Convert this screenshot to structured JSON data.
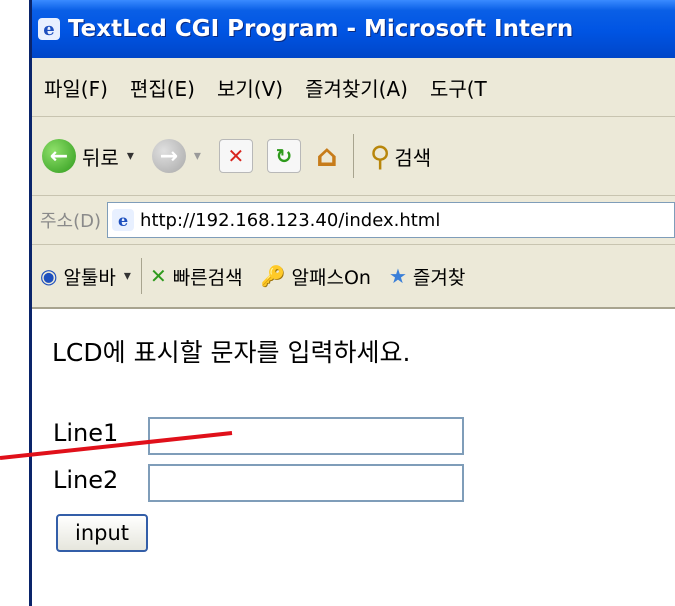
{
  "titlebar": {
    "title": "TextLcd CGI Program - Microsoft Intern"
  },
  "menubar": {
    "items": [
      "파일(F)",
      "편집(E)",
      "보기(V)",
      "즐겨찾기(A)",
      "도구(T"
    ]
  },
  "toolbar": {
    "back_label": "뒤로",
    "search_label": "검색",
    "dropdown_glyph": "▾"
  },
  "address": {
    "label": "주소(D)",
    "url": "http://192.168.123.40/index.html"
  },
  "links": {
    "items": [
      {
        "icon": "alt-toolbar-icon",
        "label": "알툴바",
        "glyph": "◉"
      },
      {
        "icon": "quick-search-icon",
        "label": "빠른검색",
        "glyph": "✕"
      },
      {
        "icon": "key-icon",
        "label": "알패스On",
        "glyph": "🔑"
      },
      {
        "icon": "star-icon",
        "label": "즐겨찾",
        "glyph": "★"
      }
    ]
  },
  "page": {
    "instruction": "LCD에 표시할 문자를 입력하세요.",
    "line1_label": "Line1",
    "line2_label": "Line2",
    "line1_value": "",
    "line2_value": "",
    "submit_label": "input"
  },
  "colors": {
    "titlebar": "#0054E3",
    "chrome": "#ECE9D8",
    "input_border": "#7F9DB9",
    "annotation": "#E0101A"
  }
}
